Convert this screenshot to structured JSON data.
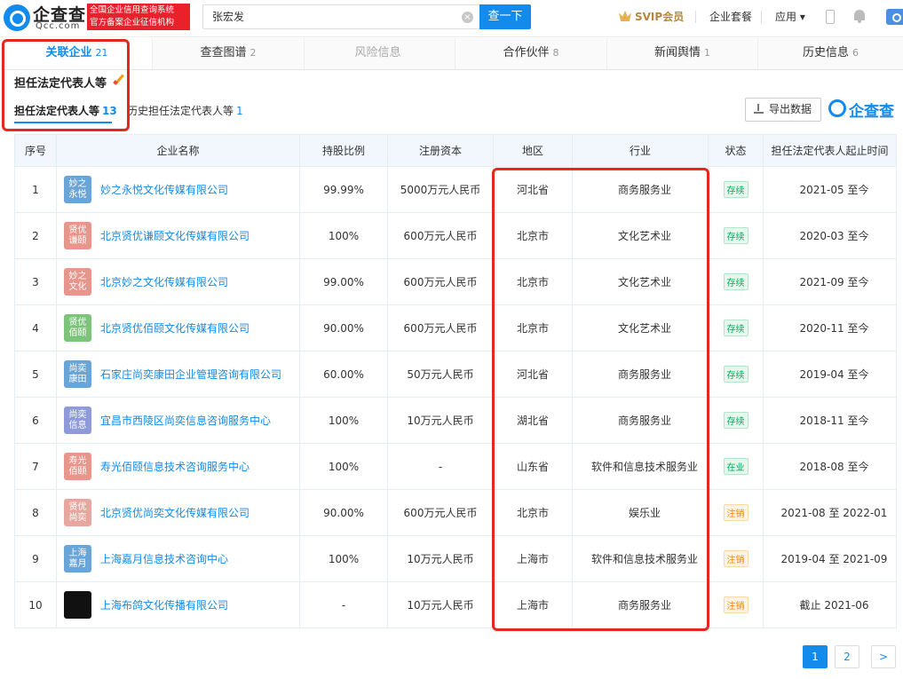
{
  "header": {
    "logo_cn": "企查查",
    "logo_en": "Qcc.com",
    "badge_line1": "全国企业信用查询系统",
    "badge_line2": "官方备案企业征信机构",
    "search_value": "张宏发",
    "clear_glyph": "×",
    "search_button": "查一下",
    "svip": "SVIP会员",
    "package": "企业套餐",
    "apps": "应用 ▾"
  },
  "tabs": [
    {
      "label": "关联企业",
      "count": "21"
    },
    {
      "label": "查查图谱",
      "count": "2"
    },
    {
      "label": "风险信息",
      "count": ""
    },
    {
      "label": "合作伙伴",
      "count": "8"
    },
    {
      "label": "新闻舆情",
      "count": "1"
    },
    {
      "label": "历史信息",
      "count": "6"
    }
  ],
  "section_title": "担任法定代表人等",
  "subtabs": [
    {
      "label": "担任法定代表人等",
      "count": "13"
    },
    {
      "label": "历史担任法定代表人等",
      "count": "1"
    }
  ],
  "export_label": "导出数据",
  "brand_text": "企查查",
  "columns": [
    "序号",
    "企业名称",
    "持股比例",
    "注册资本",
    "地区",
    "行业",
    "状态",
    "担任法定代表人起止时间"
  ],
  "rows": [
    {
      "no": "1",
      "avatar": "妙之永悦",
      "avatar_color": "#6aa5d8",
      "name": "妙之永悦文化传媒有限公司",
      "share": "99.99%",
      "capital": "5000万元人民币",
      "region": "河北省",
      "industry": "商务服务业",
      "status": "存续",
      "status_type": "ok",
      "period": "2021-05 至今"
    },
    {
      "no": "2",
      "avatar": "贤优谦颐",
      "avatar_color": "#e8958c",
      "name": "北京贤优谦颐文化传媒有限公司",
      "share": "100%",
      "capital": "600万元人民币",
      "region": "北京市",
      "industry": "文化艺术业",
      "status": "存续",
      "status_type": "ok",
      "period": "2020-03 至今"
    },
    {
      "no": "3",
      "avatar": "妙之文化",
      "avatar_color": "#e8958c",
      "name": "北京妙之文化传媒有限公司",
      "share": "99.00%",
      "capital": "600万元人民币",
      "region": "北京市",
      "industry": "文化艺术业",
      "status": "存续",
      "status_type": "ok",
      "period": "2021-09 至今"
    },
    {
      "no": "4",
      "avatar": "贤优佰颐",
      "avatar_color": "#7cc47a",
      "name": "北京贤优佰颐文化传媒有限公司",
      "share": "90.00%",
      "capital": "600万元人民币",
      "region": "北京市",
      "industry": "文化艺术业",
      "status": "存续",
      "status_type": "ok",
      "period": "2020-11 至今"
    },
    {
      "no": "5",
      "avatar": "尚奕康田",
      "avatar_color": "#6aa5d8",
      "name": "石家庄尚奕康田企业管理咨询有限公司",
      "share": "60.00%",
      "capital": "50万元人民币",
      "region": "河北省",
      "industry": "商务服务业",
      "status": "存续",
      "status_type": "ok",
      "period": "2019-04 至今"
    },
    {
      "no": "6",
      "avatar": "尚奕信息",
      "avatar_color": "#8e9bd8",
      "name": "宜昌市西陵区尚奕信息咨询服务中心",
      "share": "100%",
      "capital": "10万元人民币",
      "region": "湖北省",
      "industry": "商务服务业",
      "status": "存续",
      "status_type": "ok",
      "period": "2018-11 至今"
    },
    {
      "no": "7",
      "avatar": "寿光佰颐",
      "avatar_color": "#e8958c",
      "name": "寿光佰颐信息技术咨询服务中心",
      "share": "100%",
      "capital": "-",
      "region": "山东省",
      "industry": "软件和信息技术服务业",
      "status": "在业",
      "status_type": "ok",
      "period": "2018-08 至今"
    },
    {
      "no": "8",
      "avatar": "贤优尚奕",
      "avatar_color": "#e8a79e",
      "name": "北京贤优尚奕文化传媒有限公司",
      "share": "90.00%",
      "capital": "600万元人民币",
      "region": "北京市",
      "industry": "娱乐业",
      "status": "注销",
      "status_type": "bad",
      "period": "2021-08 至 2022-01"
    },
    {
      "no": "9",
      "avatar": "上海嘉月",
      "avatar_color": "#6aa5d8",
      "name": "上海嘉月信息技术咨询中心",
      "share": "100%",
      "capital": "10万元人民币",
      "region": "上海市",
      "industry": "软件和信息技术服务业",
      "status": "注销",
      "status_type": "bad",
      "period": "2019-04 至 2021-09"
    },
    {
      "no": "10",
      "avatar": "",
      "avatar_color": "#111111",
      "name": "上海布鸽文化传播有限公司",
      "share": "-",
      "capital": "10万元人民币",
      "region": "上海市",
      "industry": "商务服务业",
      "status": "注销",
      "status_type": "bad",
      "period": "截止 2021-06"
    }
  ],
  "pagination": {
    "pages": [
      "1",
      "2"
    ],
    "current": "1",
    "next": ">"
  }
}
